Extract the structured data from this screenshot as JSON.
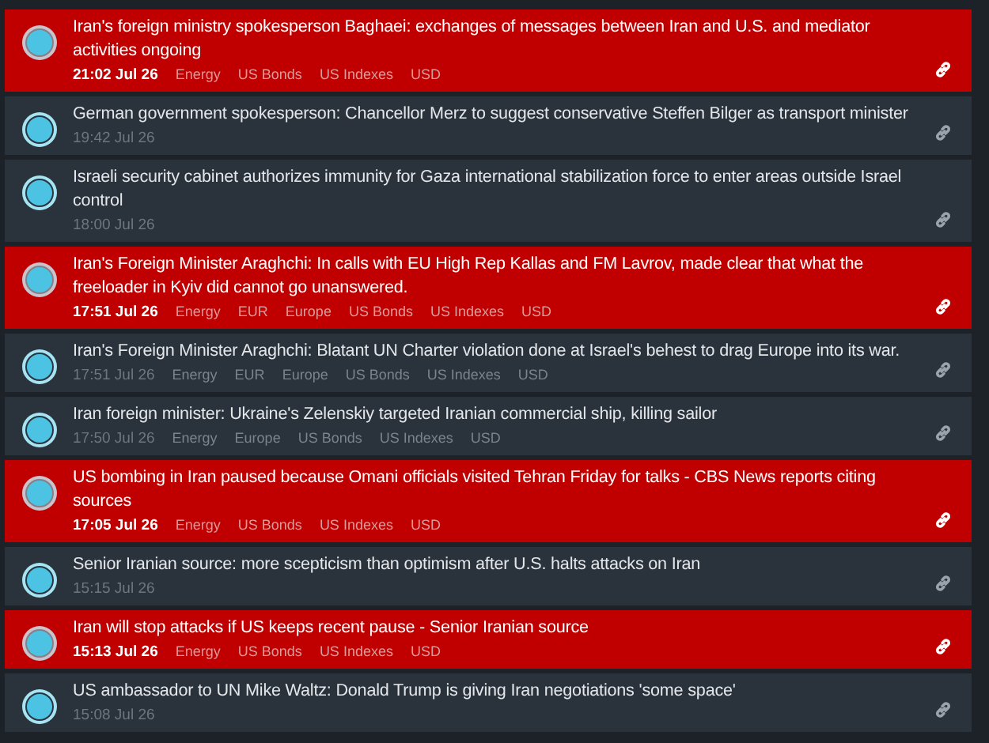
{
  "news": [
    {
      "highlighted": true,
      "headline": "Iran's foreign ministry spokesperson Baghaei: exchanges of messages between Iran and U.S. and mediator activities ongoing",
      "time": "21:02 Jul 26",
      "tags": [
        "Energy",
        "US Bonds",
        "US Indexes",
        "USD"
      ]
    },
    {
      "highlighted": false,
      "headline": "German government spokesperson: Chancellor Merz to suggest conservative Steffen Bilger as transport minister",
      "time": "19:42 Jul 26"
    },
    {
      "highlighted": false,
      "headline": "Israeli security cabinet authorizes immunity for Gaza international stabilization force to enter areas outside Israel control",
      "time": "18:00 Jul 26"
    },
    {
      "highlighted": true,
      "headline": "Iran's Foreign Minister Araghchi: In calls with EU High Rep Kallas and FM Lavrov, made clear that what the freeloader in Kyiv did cannot go unanswered.",
      "time": "17:51 Jul 26",
      "tags": [
        "Energy",
        "EUR",
        "Europe",
        "US Bonds",
        "US Indexes",
        "USD"
      ]
    },
    {
      "highlighted": false,
      "headline": "Iran's Foreign Minister Araghchi: Blatant UN Charter violation done at Israel's behest to drag Europe into its war.",
      "time": "17:51 Jul 26",
      "tags": [
        "Energy",
        "EUR",
        "Europe",
        "US Bonds",
        "US Indexes",
        "USD"
      ]
    },
    {
      "highlighted": false,
      "headline": "Iran foreign minister: Ukraine's Zelenskiy targeted Iranian commercial ship, killing sailor",
      "time": "17:50 Jul 26",
      "tags": [
        "Energy",
        "Europe",
        "US Bonds",
        "US Indexes",
        "USD"
      ]
    },
    {
      "highlighted": true,
      "headline": "US bombing in Iran paused because Omani officials visited Tehran Friday for talks - CBS News reports citing sources",
      "time": "17:05 Jul 26",
      "tags": [
        "Energy",
        "US Bonds",
        "US Indexes",
        "USD"
      ]
    },
    {
      "highlighted": false,
      "headline": "Senior Iranian source: more scepticism than optimism after U.S. halts attacks on Iran",
      "time": "15:15 Jul 26"
    },
    {
      "highlighted": true,
      "headline": "Iran will stop attacks if US keeps recent pause - Senior Iranian source",
      "time": "15:13 Jul 26",
      "tags": [
        "Energy",
        "US Bonds",
        "US Indexes",
        "USD"
      ]
    },
    {
      "highlighted": false,
      "headline": "US ambassador to UN Mike Waltz: Donald Trump is giving Iran negotiations 'some space'",
      "time": "15:08 Jul 26"
    }
  ]
}
